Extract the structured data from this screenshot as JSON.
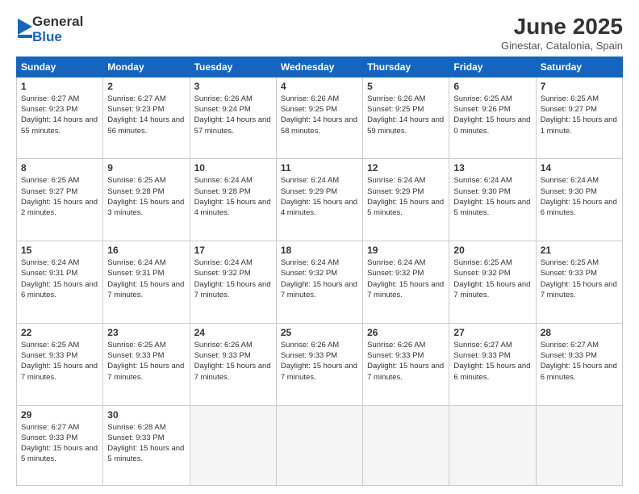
{
  "logo": {
    "general": "General",
    "blue": "Blue"
  },
  "header": {
    "month": "June 2025",
    "location": "Ginestar, Catalonia, Spain"
  },
  "weekdays": [
    "Sunday",
    "Monday",
    "Tuesday",
    "Wednesday",
    "Thursday",
    "Friday",
    "Saturday"
  ],
  "days": [
    {
      "num": "1",
      "sunrise": "6:27 AM",
      "sunset": "9:23 PM",
      "daylight": "14 hours and 55 minutes."
    },
    {
      "num": "2",
      "sunrise": "6:27 AM",
      "sunset": "9:23 PM",
      "daylight": "14 hours and 56 minutes."
    },
    {
      "num": "3",
      "sunrise": "6:26 AM",
      "sunset": "9:24 PM",
      "daylight": "14 hours and 57 minutes."
    },
    {
      "num": "4",
      "sunrise": "6:26 AM",
      "sunset": "9:25 PM",
      "daylight": "14 hours and 58 minutes."
    },
    {
      "num": "5",
      "sunrise": "6:26 AM",
      "sunset": "9:25 PM",
      "daylight": "14 hours and 59 minutes."
    },
    {
      "num": "6",
      "sunrise": "6:25 AM",
      "sunset": "9:26 PM",
      "daylight": "15 hours and 0 minutes."
    },
    {
      "num": "7",
      "sunrise": "6:25 AM",
      "sunset": "9:27 PM",
      "daylight": "15 hours and 1 minute."
    },
    {
      "num": "8",
      "sunrise": "6:25 AM",
      "sunset": "9:27 PM",
      "daylight": "15 hours and 2 minutes."
    },
    {
      "num": "9",
      "sunrise": "6:25 AM",
      "sunset": "9:28 PM",
      "daylight": "15 hours and 3 minutes."
    },
    {
      "num": "10",
      "sunrise": "6:24 AM",
      "sunset": "9:28 PM",
      "daylight": "15 hours and 4 minutes."
    },
    {
      "num": "11",
      "sunrise": "6:24 AM",
      "sunset": "9:29 PM",
      "daylight": "15 hours and 4 minutes."
    },
    {
      "num": "12",
      "sunrise": "6:24 AM",
      "sunset": "9:29 PM",
      "daylight": "15 hours and 5 minutes."
    },
    {
      "num": "13",
      "sunrise": "6:24 AM",
      "sunset": "9:30 PM",
      "daylight": "15 hours and 5 minutes."
    },
    {
      "num": "14",
      "sunrise": "6:24 AM",
      "sunset": "9:30 PM",
      "daylight": "15 hours and 6 minutes."
    },
    {
      "num": "15",
      "sunrise": "6:24 AM",
      "sunset": "9:31 PM",
      "daylight": "15 hours and 6 minutes."
    },
    {
      "num": "16",
      "sunrise": "6:24 AM",
      "sunset": "9:31 PM",
      "daylight": "15 hours and 7 minutes."
    },
    {
      "num": "17",
      "sunrise": "6:24 AM",
      "sunset": "9:32 PM",
      "daylight": "15 hours and 7 minutes."
    },
    {
      "num": "18",
      "sunrise": "6:24 AM",
      "sunset": "9:32 PM",
      "daylight": "15 hours and 7 minutes."
    },
    {
      "num": "19",
      "sunrise": "6:24 AM",
      "sunset": "9:32 PM",
      "daylight": "15 hours and 7 minutes."
    },
    {
      "num": "20",
      "sunrise": "6:25 AM",
      "sunset": "9:32 PM",
      "daylight": "15 hours and 7 minutes."
    },
    {
      "num": "21",
      "sunrise": "6:25 AM",
      "sunset": "9:33 PM",
      "daylight": "15 hours and 7 minutes."
    },
    {
      "num": "22",
      "sunrise": "6:25 AM",
      "sunset": "9:33 PM",
      "daylight": "15 hours and 7 minutes."
    },
    {
      "num": "23",
      "sunrise": "6:25 AM",
      "sunset": "9:33 PM",
      "daylight": "15 hours and 7 minutes."
    },
    {
      "num": "24",
      "sunrise": "6:26 AM",
      "sunset": "9:33 PM",
      "daylight": "15 hours and 7 minutes."
    },
    {
      "num": "25",
      "sunrise": "6:26 AM",
      "sunset": "9:33 PM",
      "daylight": "15 hours and 7 minutes."
    },
    {
      "num": "26",
      "sunrise": "6:26 AM",
      "sunset": "9:33 PM",
      "daylight": "15 hours and 7 minutes."
    },
    {
      "num": "27",
      "sunrise": "6:27 AM",
      "sunset": "9:33 PM",
      "daylight": "15 hours and 6 minutes."
    },
    {
      "num": "28",
      "sunrise": "6:27 AM",
      "sunset": "9:33 PM",
      "daylight": "15 hours and 6 minutes."
    },
    {
      "num": "29",
      "sunrise": "6:27 AM",
      "sunset": "9:33 PM",
      "daylight": "15 hours and 5 minutes."
    },
    {
      "num": "30",
      "sunrise": "6:28 AM",
      "sunset": "9:33 PM",
      "daylight": "15 hours and 5 minutes."
    }
  ]
}
